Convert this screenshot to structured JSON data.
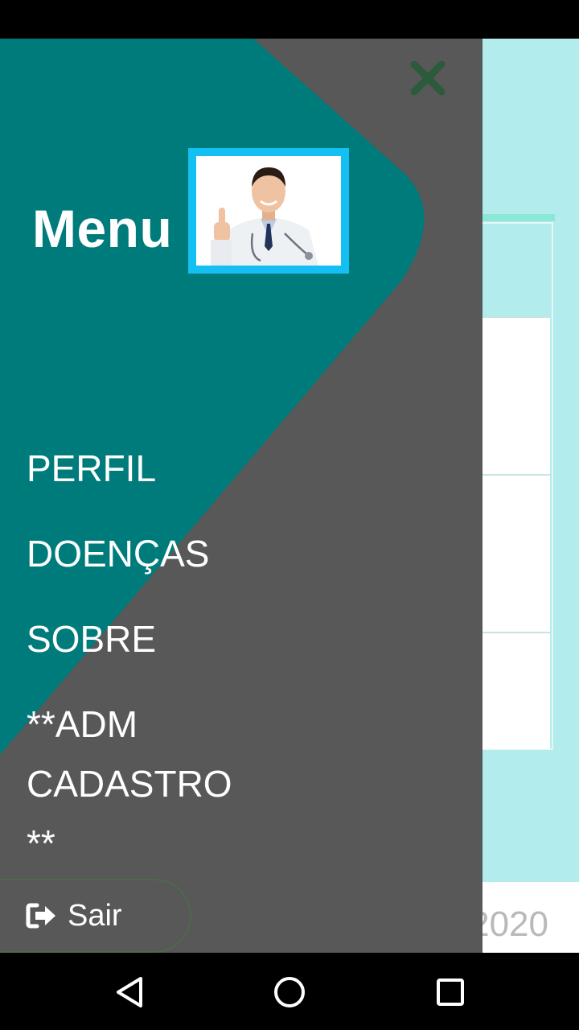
{
  "app": {
    "footer_year": "2020"
  },
  "drawer": {
    "title": "Menu",
    "avatar_icon": "doctor-photo",
    "items": [
      {
        "label": "PERFIL"
      },
      {
        "label": "DOENÇAS"
      },
      {
        "label": "SOBRE"
      },
      {
        "label": "**ADM CADASTRO **"
      }
    ],
    "logout_label": "Sair",
    "logout_icon": "sign-out-icon",
    "close_icon": "close-icon"
  },
  "colors": {
    "drawer_bg": "#585858",
    "teal_accent": "#007b7b",
    "avatar_border": "#13bff3",
    "close_icon": "#2b5a3c",
    "app_bg": "#b2ecec"
  },
  "system_nav": {
    "icons": [
      "back-icon",
      "home-icon",
      "recents-icon"
    ]
  }
}
